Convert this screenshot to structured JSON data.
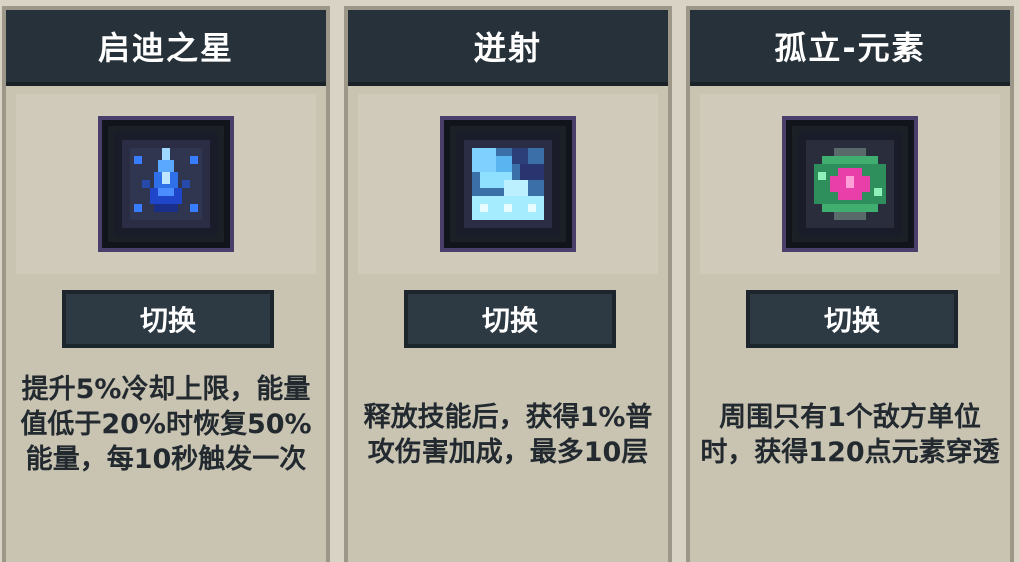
{
  "cards": [
    {
      "title": "启迪之星",
      "icon": "blue-crystal-star-icon",
      "button_label": "切换",
      "description": "提升5%冷却上限，能量值低于20%时恢复50%能量，每10秒触发一次"
    },
    {
      "title": "迸射",
      "icon": "ice-shard-burst-icon",
      "button_label": "切换",
      "description": "释放技能后，获得1%普攻伤害加成，最多10层"
    },
    {
      "title": "孤立-元素",
      "icon": "pink-green-element-gem-icon",
      "button_label": "切换",
      "description": "周围只有1个敌方单位时，获得120点元素穿透"
    }
  ],
  "colors": {
    "header_bg": "#26313a",
    "card_bg": "#c9c3b2",
    "button_bg": "#2d3a44",
    "text_dark": "#222a30"
  }
}
